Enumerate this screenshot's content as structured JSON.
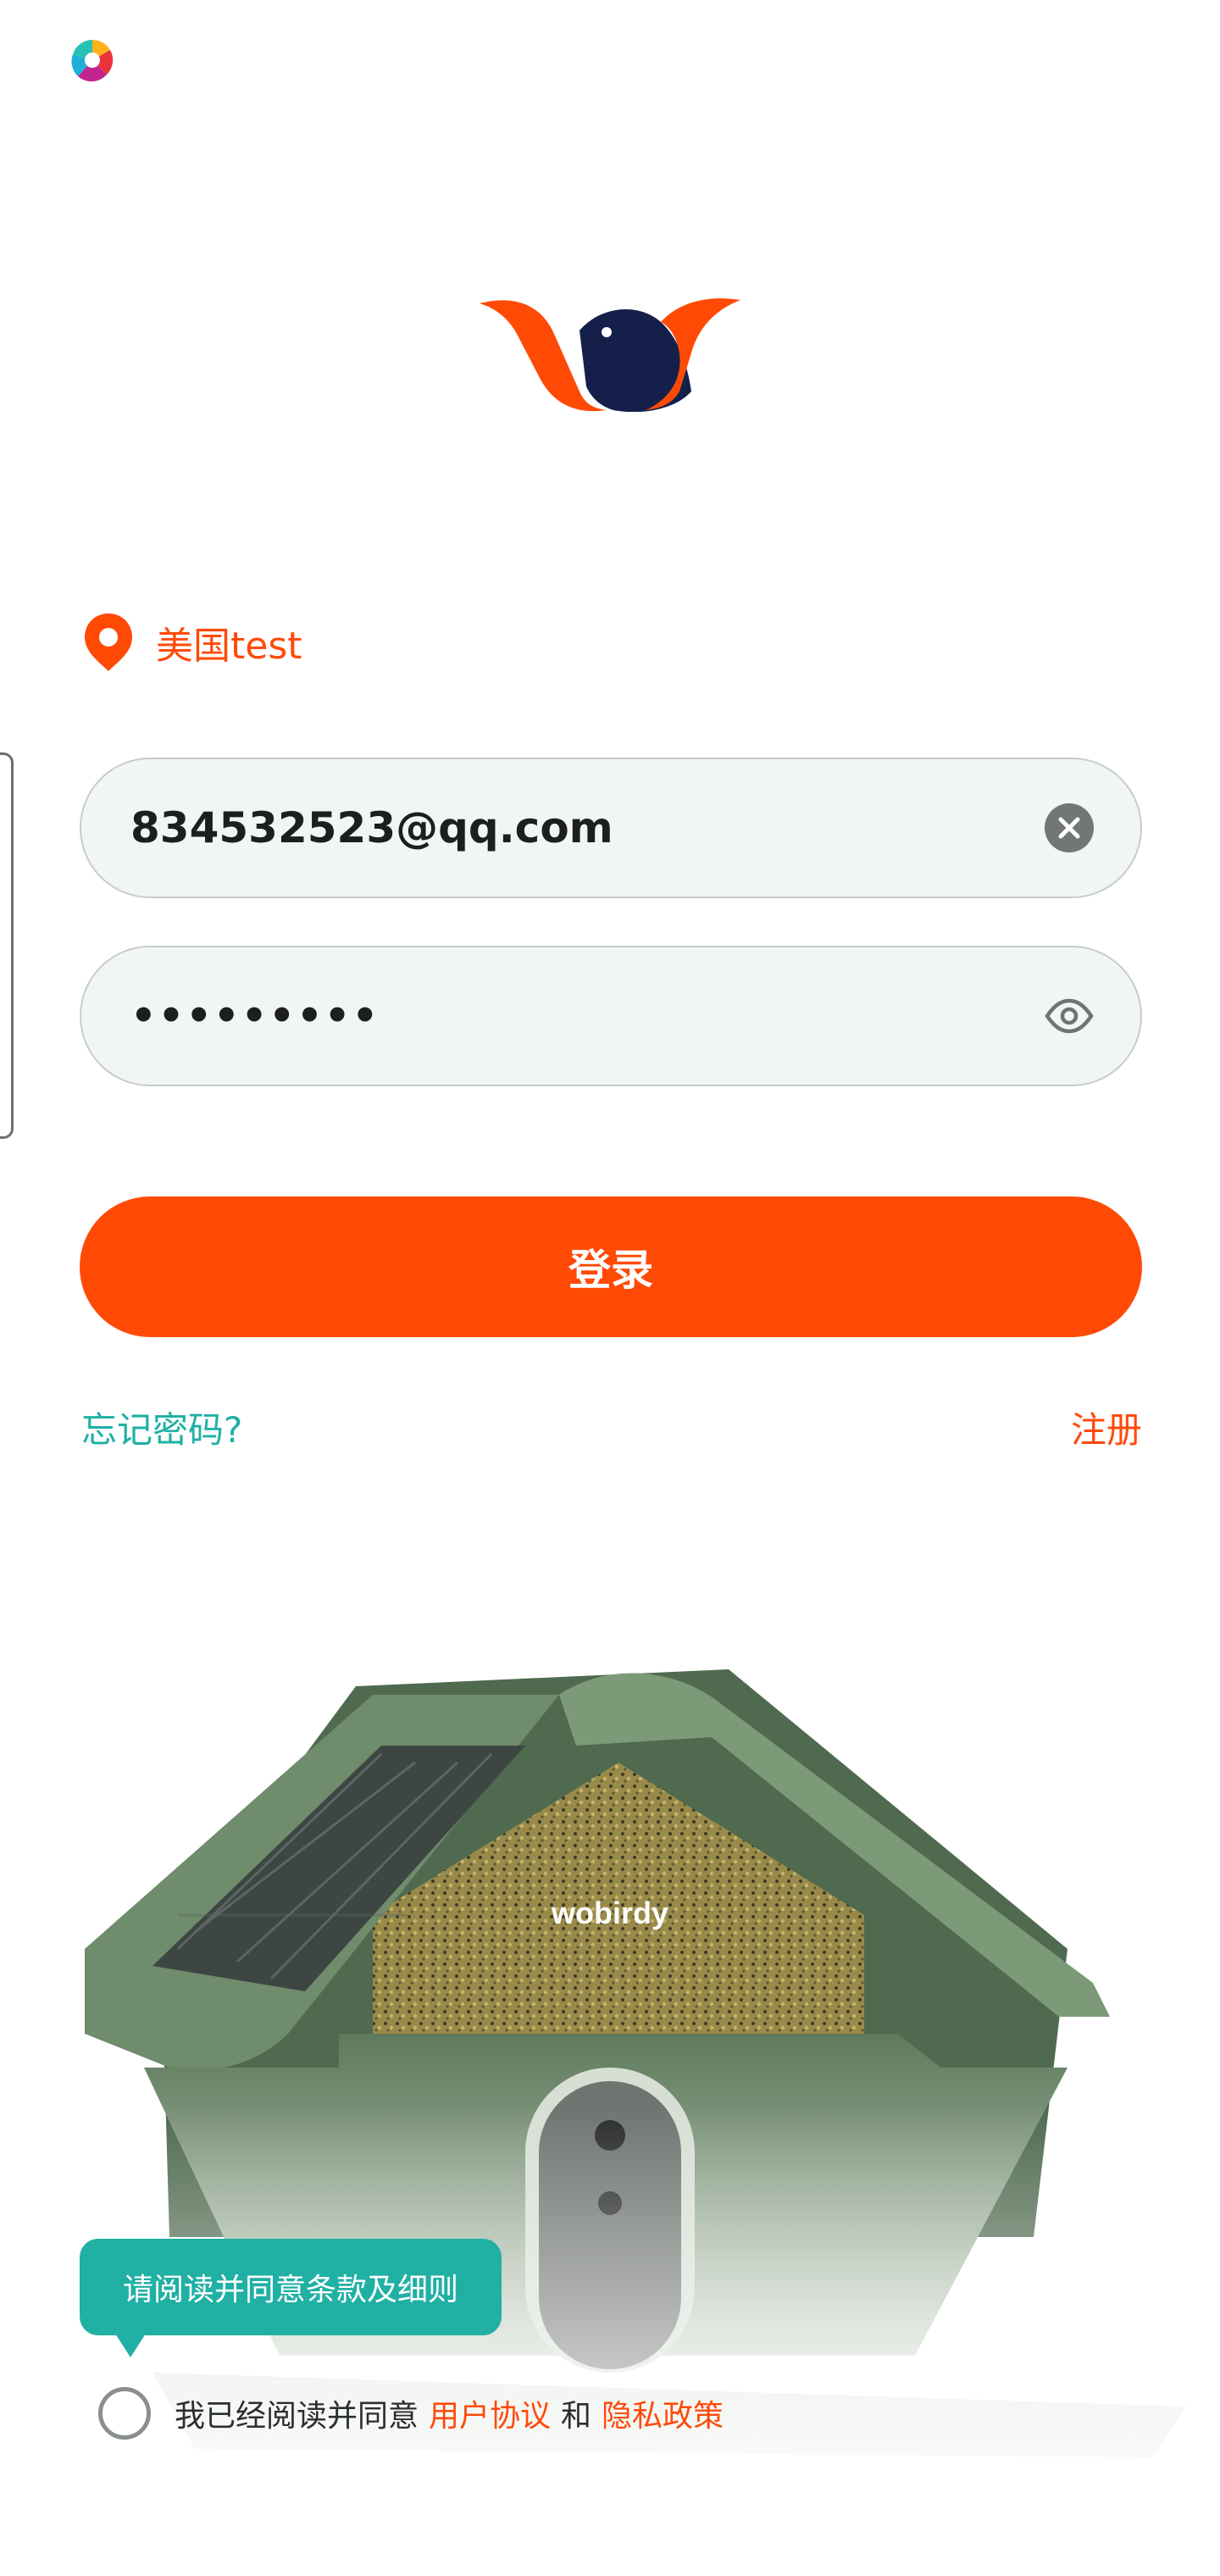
{
  "app": {
    "brand_colors": {
      "primary": "#ff4a06",
      "navy": "#14204a",
      "teal": "#20b0a4"
    }
  },
  "status_bar": {
    "icon": "app-launcher-icon"
  },
  "logo": {
    "icon": "wobirdy-w-bird-logo"
  },
  "region": {
    "icon": "location-pin-icon",
    "label": "美国test"
  },
  "email": {
    "value": "834532523@qq.com",
    "clear_icon": "clear-circle-icon"
  },
  "password": {
    "value": "•••••••••",
    "toggle_icon": "eye-icon"
  },
  "login": {
    "label": "登录"
  },
  "links": {
    "forgot": "忘记密码?",
    "register": "注册"
  },
  "product_image": {
    "brand_text": "wobirdy"
  },
  "terms": {
    "tooltip": "请阅读并同意条款及细则",
    "prefix": "我已经阅读并同意",
    "user_agreement": "用户协议",
    "and": "和",
    "privacy_policy": "隐私政策"
  }
}
